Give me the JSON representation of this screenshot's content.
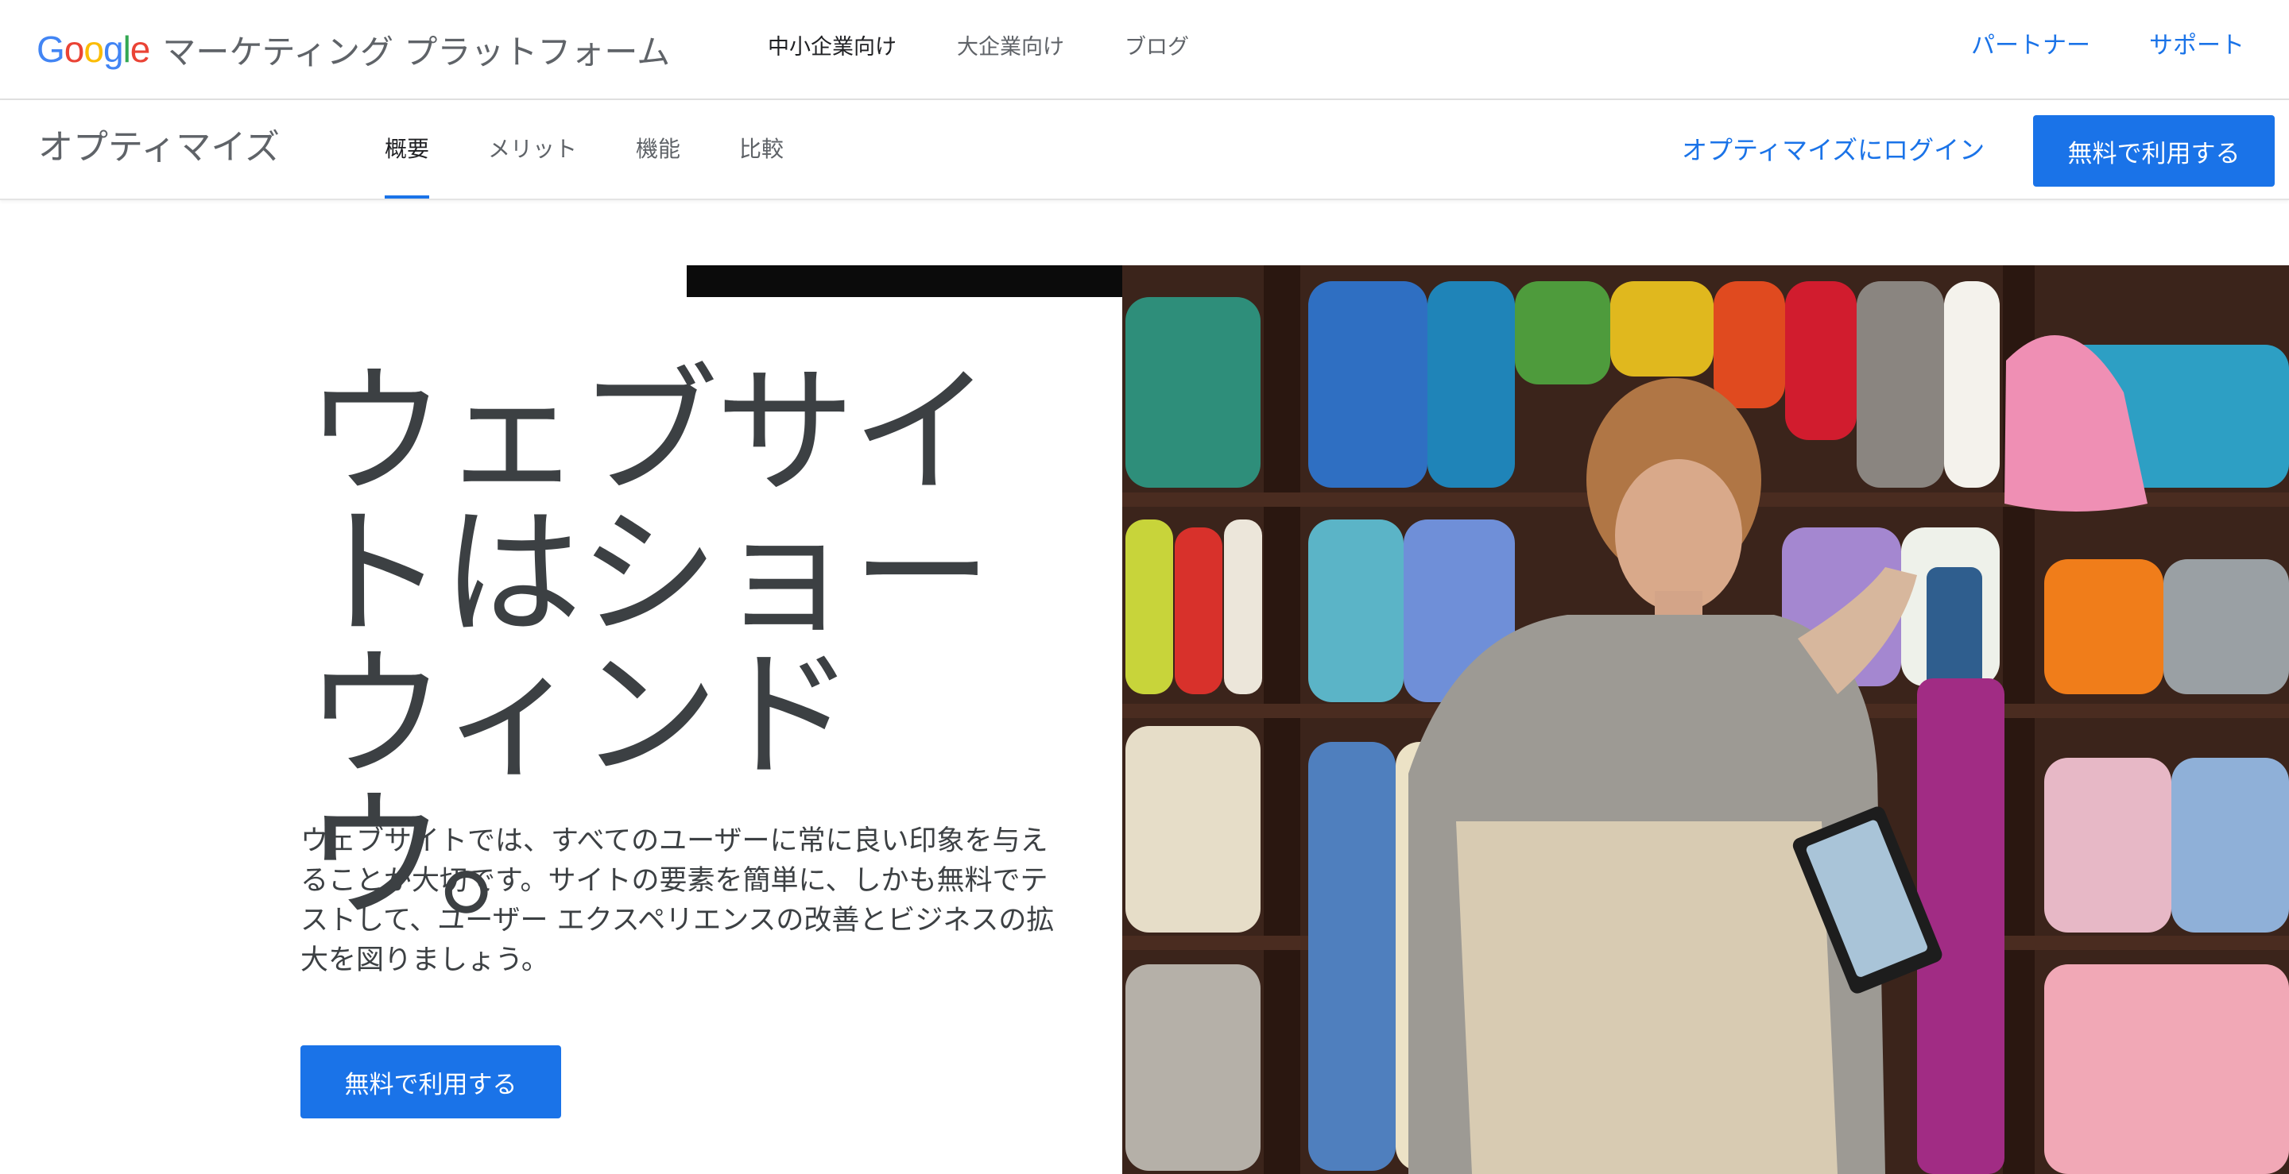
{
  "header": {
    "logo": {
      "letters": [
        "G",
        "o",
        "o",
        "g",
        "l",
        "e"
      ],
      "colors": [
        "#4285F4",
        "#EA4335",
        "#FBBC05",
        "#4285F4",
        "#34A853",
        "#EA4335"
      ]
    },
    "suffix": "マーケティング プラットフォーム",
    "nav": [
      {
        "label": "中小企業向け",
        "active": true
      },
      {
        "label": "大企業向け",
        "active": false
      },
      {
        "label": "ブログ",
        "active": false
      }
    ],
    "right_links": [
      "パートナー",
      "サポート"
    ]
  },
  "product_bar": {
    "product_name": "オプティマイズ",
    "tabs": [
      {
        "label": "概要",
        "active": true
      },
      {
        "label": "メリット",
        "active": false
      },
      {
        "label": "機能",
        "active": false
      },
      {
        "label": "比較",
        "active": false
      }
    ],
    "login_link": "オプティマイズにログイン",
    "cta": "無料で利用する"
  },
  "hero": {
    "title": "ウェブサイトはショー ウィンドウ。",
    "body": "ウェブサイトでは、すべてのユーザーに常に良い印象を与えることが大切です。サイトの要素を簡単に、しかも無料でテストして、ユーザー エクスペリエンスの改善とビジネスの拡大を図りましょう。",
    "cta": "無料で利用する",
    "image_alt": "毛糸の棚の前でタブレットを持つ女性"
  },
  "colors": {
    "accent": "#1a73e8",
    "text": "#3c4043",
    "muted": "#5f6368"
  }
}
